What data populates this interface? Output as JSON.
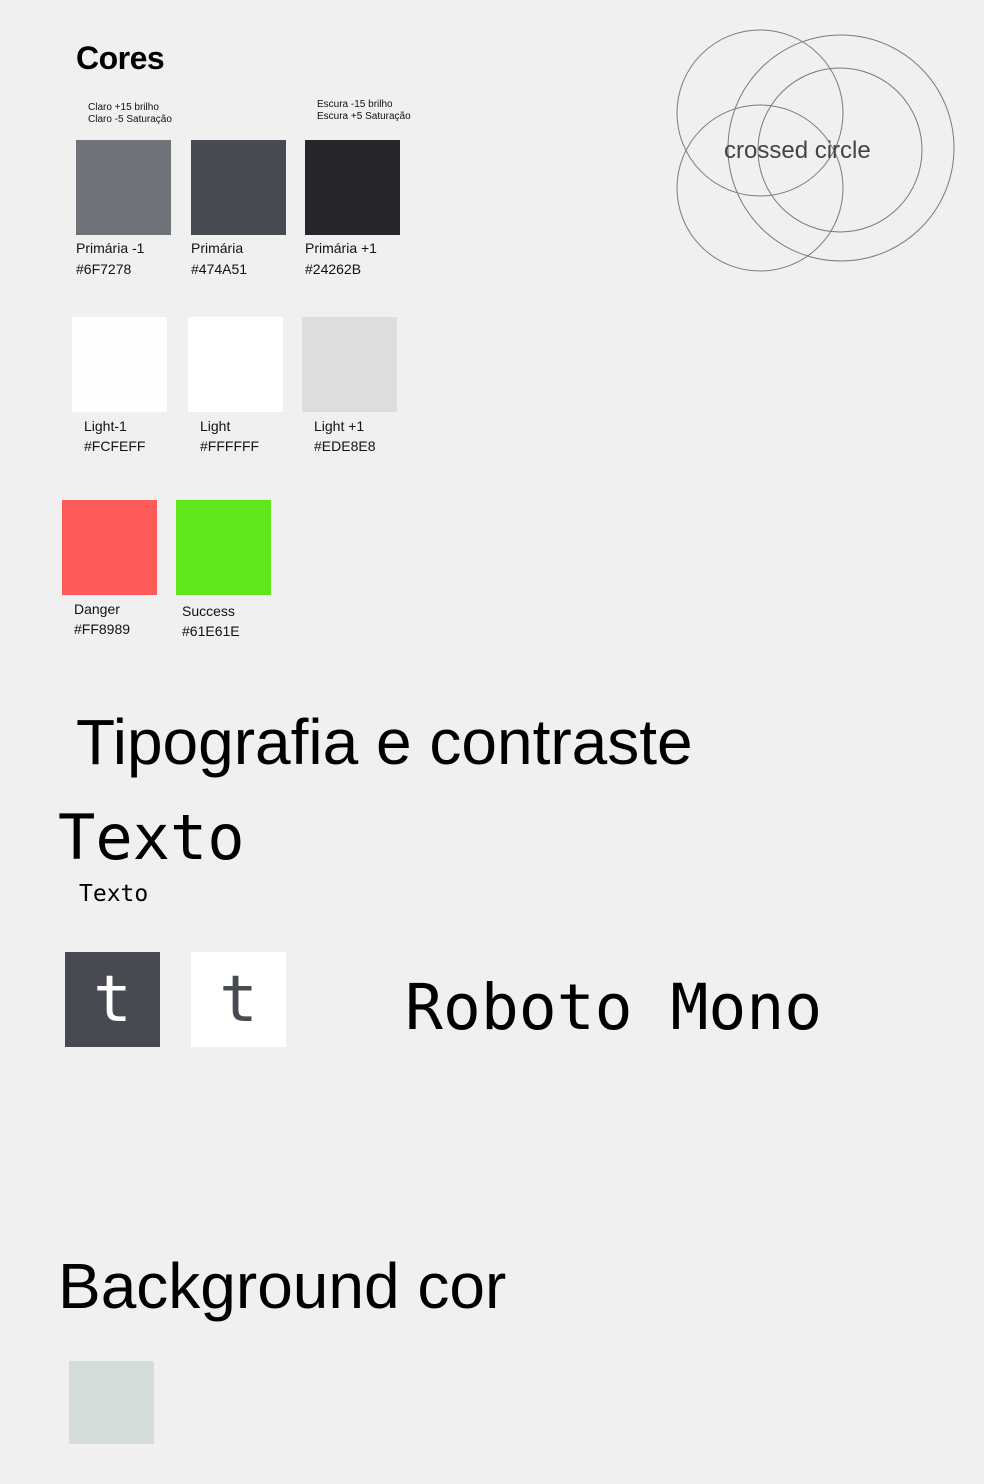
{
  "cores": {
    "title": "Cores",
    "note_light": [
      "Claro  +15 brilho",
      "Claro -5 Saturação"
    ],
    "note_dark": [
      "Escura -15 brilho",
      "Escura +5 Saturação"
    ]
  },
  "primary_swatches": [
    {
      "name": "Primária -1",
      "hex": "#6F7278",
      "color": "#6F7278"
    },
    {
      "name": "Primária",
      "hex": "#474A51",
      "color": "#474A51"
    },
    {
      "name": "Primária +1",
      "hex": "#24262B",
      "color": "#24262B"
    }
  ],
  "light_swatches": [
    {
      "name": "Light-1",
      "hex": "#FCFEFF",
      "color": "#FCFEFF"
    },
    {
      "name": "Light",
      "hex": "#FFFFFF",
      "color": "#FFFFFF"
    },
    {
      "name": "Light +1",
      "hex": "#EDE8E8",
      "color": "#DCDDDF"
    }
  ],
  "status_swatches": [
    {
      "name": "Danger",
      "hex": "#FF8989",
      "color": "#FF5A5A"
    },
    {
      "name": "Success",
      "hex": "#61E61E",
      "color": "#61E61E"
    }
  ],
  "venn": {
    "label": "crossed circle",
    "stroke": "#7A7A7A"
  },
  "typography": {
    "heading": "Tipografia e contraste",
    "texto_large": "Texto",
    "texto_small": "Texto",
    "sample_dark": {
      "letter": "t",
      "bg": "#474A51",
      "fg": "#FFFFFF"
    },
    "sample_light": {
      "letter": "t",
      "bg": "#FFFFFF",
      "fg": "#474A51"
    },
    "font_name": "Roboto Mono"
  },
  "background": {
    "heading": "Background cor",
    "swatch_color": "#D5DDDA"
  }
}
